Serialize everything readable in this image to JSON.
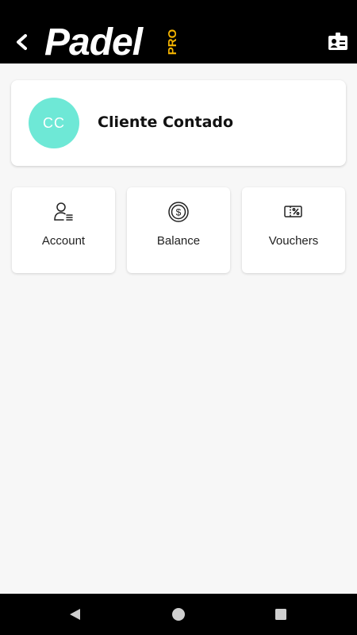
{
  "header": {
    "logo_main": "Padel",
    "logo_accent": "PRO",
    "accent_color": "#f5b400",
    "back_icon": "chevron-left-icon",
    "right_icon": "id-card-icon"
  },
  "profile": {
    "initials": "CC",
    "name": "Cliente Contado",
    "avatar_color": "#6ee8d6"
  },
  "tiles": [
    {
      "label": "Account",
      "icon": "user-list-icon"
    },
    {
      "label": "Balance",
      "icon": "dollar-coin-icon"
    },
    {
      "label": "Vouchers",
      "icon": "voucher-percent-icon"
    }
  ],
  "system_nav": {
    "back": "triangle-back-icon",
    "home": "circle-home-icon",
    "recents": "square-recents-icon"
  }
}
